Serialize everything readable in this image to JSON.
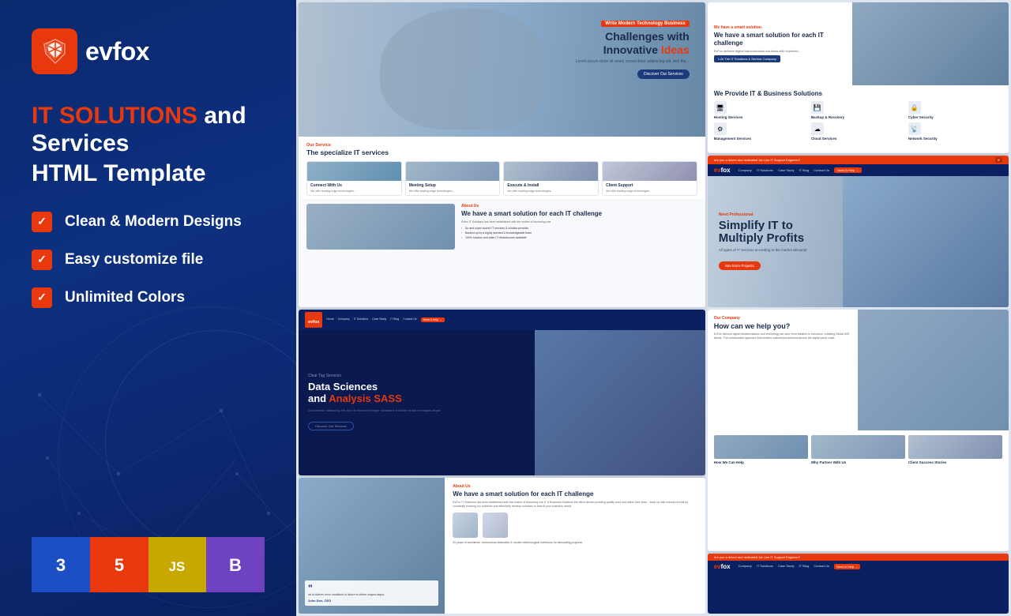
{
  "left": {
    "logo_text": "evfox",
    "headline": {
      "red_part": "IT SOLUTIONS",
      "white_part": " and  Services",
      "line2": "HTML Template"
    },
    "features": [
      "Clean & Modern Designs",
      "Easy customize file",
      "Unlimited Colors"
    ],
    "badges": [
      {
        "label": "3",
        "style": "css"
      },
      {
        "label": "5",
        "style": "html"
      },
      {
        "label": "JS",
        "style": "js"
      },
      {
        "label": "B",
        "style": "bootstrap"
      }
    ]
  },
  "screenshots": {
    "main": {
      "pretag": "Write Modern Technology Business",
      "title_line1": "Challenges with",
      "title_line2": "Innovative ",
      "title_highlight": "Ideas",
      "subtitle": "Lorem ipsum dolor sit amet, consectetur adipiscing elit, and the...",
      "btn": "Discover Our Services",
      "services_tag": "Our Service",
      "services_title": "The specialize IT services",
      "cards": [
        {
          "title": "Connect With Us",
          "text": "We offer leading-edge technologies..."
        },
        {
          "title": "Meeting Setup",
          "text": "We offer leading-edge technologies..."
        },
        {
          "title": "Execute & Install",
          "text": "We offer leading-edge technologies..."
        },
        {
          "title": "Client Support",
          "text": "We offer leading-edge technologies..."
        }
      ],
      "smart_tag": "About Us",
      "smart_title": "We have a smart solution for each IT challenge",
      "smart_text": "Evfox IT Solutions has been established with the motive of becoming one...",
      "smart_items": [
        "An and super scored IT services & solution provider",
        "Backed up by a highly talented & knowledgeable team",
        "100% solution and state IT infrastructure available"
      ]
    },
    "top_right_1": {
      "company_title": "We have a smart solution for each IT challenge",
      "company_sub": "1.2k The IT Solutions & Service Company",
      "it_title": "We Provide IT & Business Solutions",
      "services": [
        "Hosting Services",
        "Backup & Recovery",
        "Cyber Security",
        "Management Services",
        "Cloud Services",
        "Network Security"
      ]
    },
    "top_right_2": {
      "navbar_announce": "Are you a driven and motivated 1st Line IT Support Engineer?",
      "nav_items": [
        "Company",
        "IT Solutions",
        "Case Study",
        "IT Blog",
        "Contact Us",
        "Need A Help →"
      ],
      "pretag": "Need Professional",
      "title_line1": "Simplify IT to",
      "title_line2": "Multiply Profits",
      "subtitle": "All types of IT services according to the market demand!",
      "btn": "See More Projects"
    },
    "bottom_left_1": {
      "nav_logo": "evfox",
      "nav_items": [
        "Home",
        "Company",
        "IT Solutions",
        "Case Study",
        "IT Blog",
        "Contact Us",
        "Need A Help →"
      ],
      "pretag": "Clear Tag Services",
      "title_line1": "Data Sciences",
      "title_line2": "and ",
      "title_highlight": "Analysis SASS",
      "subtitle": "Consectetur adipiscing elit, sed do eiusmod tempor incididunt ut labore et dolore magna aliqua.",
      "btn": "Discover Our Services"
    },
    "bottom_left_2": {
      "about_tag": "About Us",
      "title": "We have a smart solution for each IT challenge",
      "text": "EvFox IT Solutions has been established with the motive of becoming one IT & Business Solutions the office clients providing quality work and within their lives... keep up with industry trends by constantly evolving our solutions and effectively develop solutions to best fit your business needs.",
      "footer": "20 years of excellence, tremendous dedication & modern technological inventions for stimulating progress"
    },
    "bottom_right_1": {
      "pretag": "Our Company",
      "title": "How can we help you?",
      "text": "EvFox delivers digital transformations and technology we store from ideation to execution, enabling Global 50K clients. The collaborative approach that creates customized solutions across the digital value chain.",
      "cards": [
        "How We Can Help",
        "Why Partner With Us",
        "Client Success Stories"
      ]
    },
    "bottom_right_nav": {
      "announce": "Are you a driven and motivated 1st Line IT Support Engineer?",
      "items": [
        "Company",
        "IT Solutions",
        "Case Study",
        "IT Blog",
        "Contact Us",
        "Need A Help →"
      ]
    }
  }
}
